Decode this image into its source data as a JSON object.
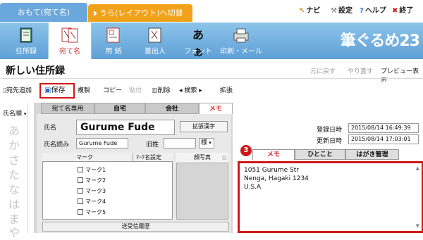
{
  "top": {
    "front_tab": "おもて(宛て名)",
    "back_tab": "うら(レイアウト)へ切替",
    "links": [
      {
        "icon": "↖",
        "label": "ナビ",
        "color": "#e08a00"
      },
      {
        "icon": "🔧",
        "label": "設定",
        "color": "#333333"
      },
      {
        "icon": "?",
        "label": "ヘルプ",
        "color": "#2a7ad8"
      },
      {
        "icon": "✖",
        "label": "終了",
        "color": "#d01818"
      }
    ]
  },
  "ribbon": {
    "buttons": [
      "住所録",
      "宛て名",
      "用 紙",
      "差出人",
      "フォント",
      "印刷・メール"
    ],
    "font_glyph": "あぁ",
    "brand": "筆ぐるめ23"
  },
  "titlebar": {
    "title": "新しい住所録",
    "undo": "元に戻す",
    "redo": "やり直す",
    "preview": "プレビュー表示"
  },
  "toolbar": {
    "add_recipient": "宛先追加",
    "save": "保存",
    "duplicate": "複製",
    "copy": "コピー",
    "paste": "貼付",
    "delete": "削除",
    "search": "検索",
    "extend": "拡張"
  },
  "left": {
    "sort": "氏名順",
    "kana": [
      "あ",
      "か",
      "さ",
      "た",
      "な",
      "は",
      "ま",
      "や"
    ]
  },
  "form": {
    "tabs": [
      "宛て名専用",
      "自宅",
      "会社",
      "メモ"
    ],
    "name_label": "氏名",
    "name_value": "Gurume  Fude",
    "kanji_button": "拡張漢字",
    "yomi_label": "氏名読み",
    "yomi_value": "Gurume Fude",
    "kyusei_label": "旧姓",
    "honorific": "様",
    "mark_header": "マーク",
    "mark_settings": "ﾏｰｸ名設定",
    "marks": [
      "マーク1",
      "マーク2",
      "マーク3",
      "マーク4",
      "マーク5"
    ],
    "photo_header": "顔写真",
    "history": "送受信履歴"
  },
  "right": {
    "registered_label": "登録日時",
    "registered_value": "2015/08/14 16:49:39",
    "updated_label": "更新日時",
    "updated_value": "2015/08/14 17:03:01",
    "badge": "3",
    "tabs": [
      "メモ",
      "ひとこと",
      "はがき管理"
    ],
    "memo": "1051 Gurume Str\nNenga, Hagaki 1234\nU.S.A"
  },
  "colors": {
    "accent_red": "#d01818",
    "front_tab_blue": "#6aa7dc",
    "back_tab_orange": "#f2a21a",
    "ribbon_blue": "#5fa0d6"
  }
}
